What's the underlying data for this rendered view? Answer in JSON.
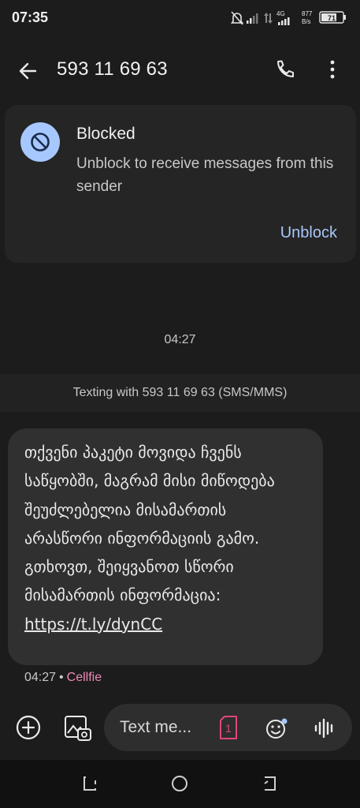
{
  "status_bar": {
    "time": "07:35",
    "network_speed_value": "877",
    "network_speed_unit": "B/s",
    "network_type": "4G",
    "battery": "71"
  },
  "app_bar": {
    "title": "593 11 69 63",
    "back_icon": "arrow-back-icon",
    "call_icon": "phone-icon",
    "more_icon": "more-vert-icon"
  },
  "blocked_card": {
    "title": "Blocked",
    "description": "Unblock to receive messages from this sender",
    "action": "Unblock"
  },
  "conversation": {
    "timestamp": "04:27",
    "texting_banner": "Texting with 593 11 69 63 (SMS/MMS)",
    "messages": [
      {
        "body": "თქვენი პაკეტი მოვიდა ჩვენს საწყობში, მაგრამ მისი მიწოდება შეუძლებელია მისამართის არასწორი ინფორმაციის გამო. გთხოვთ, შეიყვანოთ სწორი მისამართის ინფორმაცია:",
        "link": "https://t.ly/dynCC",
        "time": "04:27",
        "sender_label": "Cellfie"
      }
    ]
  },
  "composer": {
    "placeholder": "Text me...",
    "sim_label": "1"
  },
  "colors": {
    "background": "#1c1c1c",
    "accent": "#a8c7fa",
    "sim_badge": "#e0467c",
    "sender_label": "#f08ab8"
  }
}
